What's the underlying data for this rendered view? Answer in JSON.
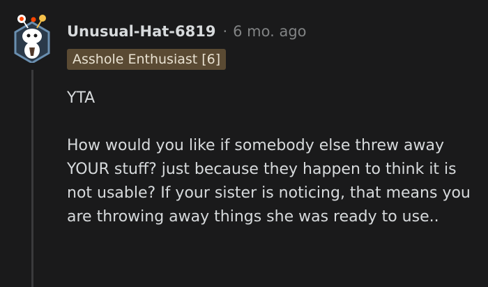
{
  "comment": {
    "author": "Unusual-Hat-6819",
    "separator": "·",
    "timestamp": "6 mo. ago",
    "flair": "Asshole Enthusiast [6]",
    "paragraphs": [
      "YTA",
      "How would you like if somebody else threw away YOUR stuff? just because they happen to think it is not usable? If your sister is noticing, that means you are throwing away things she was ready to use.."
    ]
  },
  "avatar": {
    "icon": "snoo-avatar-icon",
    "border_color": "#6a8fb0",
    "accent_colors": [
      "#f5c04a",
      "#ff4500",
      "#ffffff"
    ]
  },
  "colors": {
    "background": "#1a1a1b",
    "text": "#d7dadc",
    "meta": "#818384",
    "flair_bg": "#5a4a33",
    "thread_line": "#3a3a3c"
  }
}
